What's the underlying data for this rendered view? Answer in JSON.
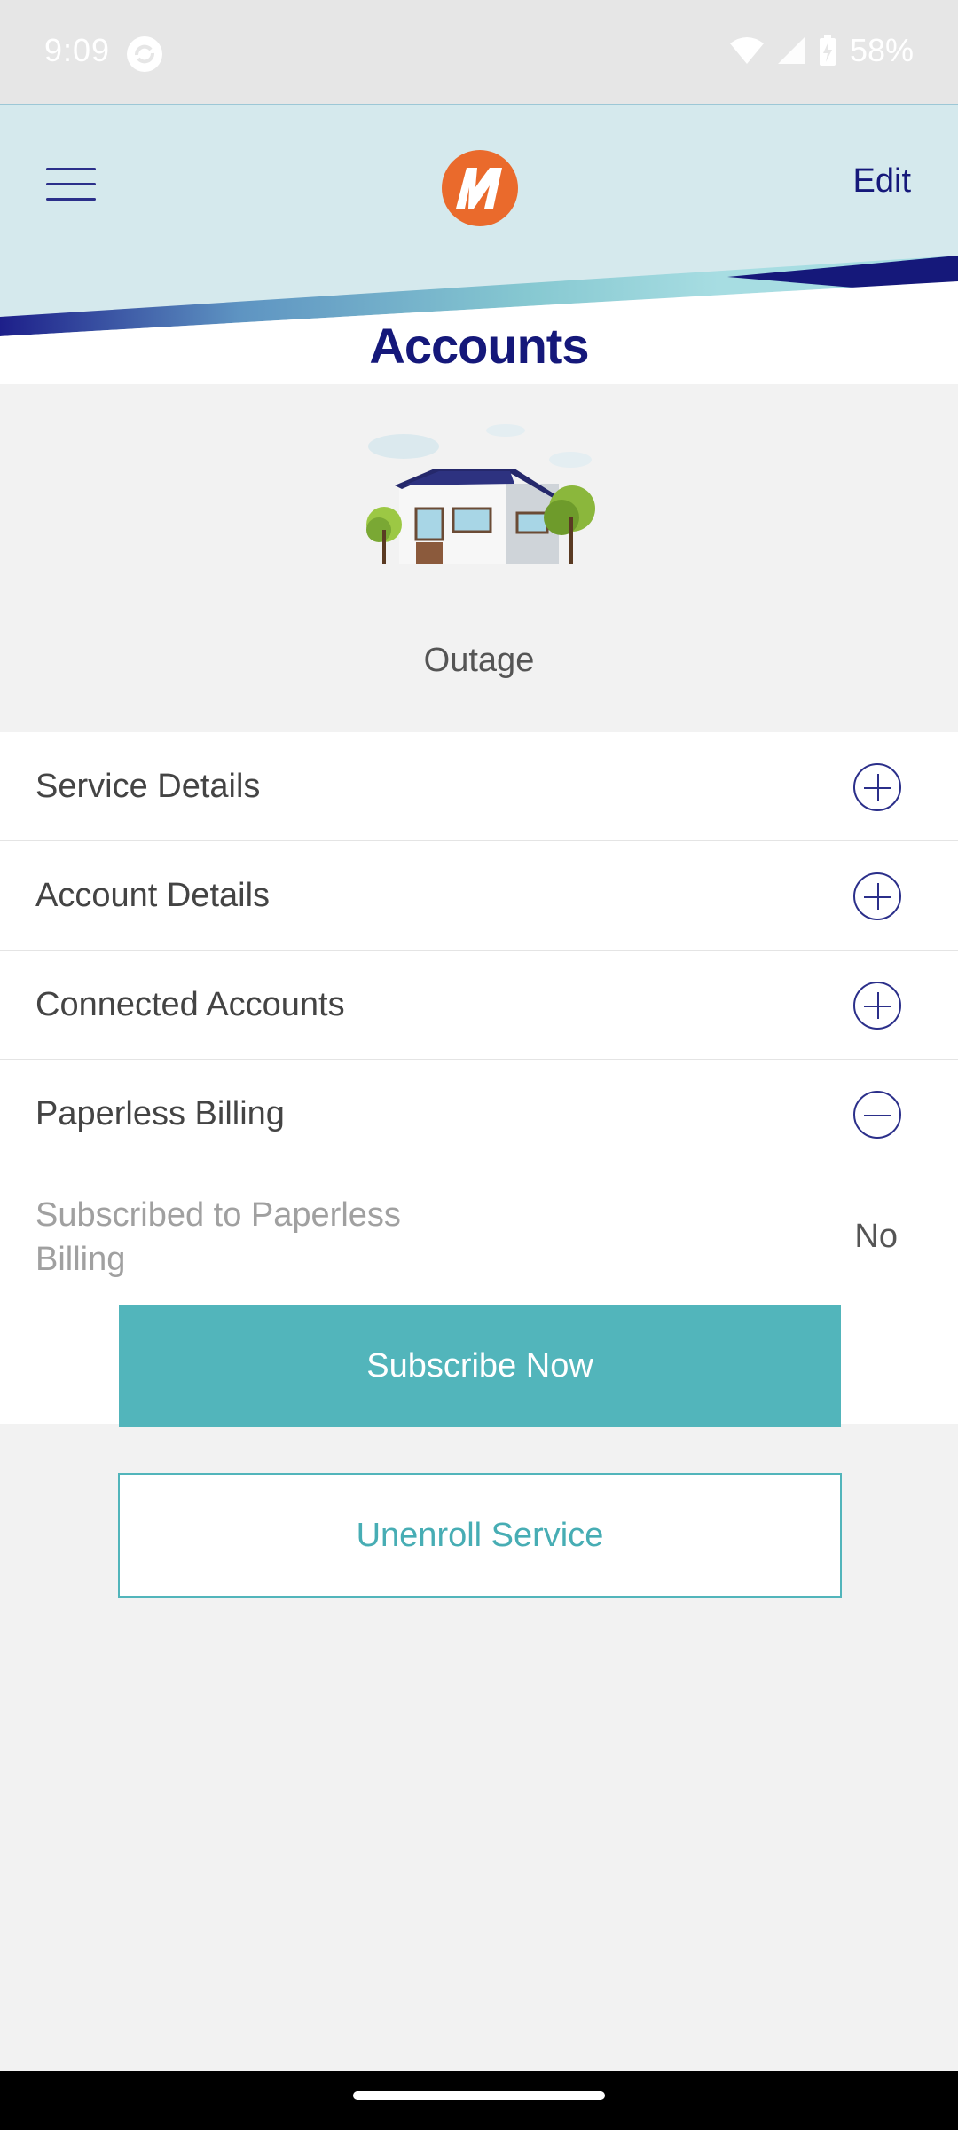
{
  "status_bar": {
    "time": "9:09",
    "battery": "58%",
    "icons": [
      "sync-icon",
      "wifi-icon",
      "signal-icon",
      "battery-charging-icon"
    ]
  },
  "header": {
    "menu_icon": "hamburger-menu-icon",
    "logo_icon": "lightning-m-logo-icon",
    "edit_label": "Edit",
    "title": "Accounts"
  },
  "outage": {
    "image": "house-illustration",
    "label": "Outage"
  },
  "sections": [
    {
      "label": "Service Details",
      "state": "collapsed"
    },
    {
      "label": "Account Details",
      "state": "collapsed"
    },
    {
      "label": "Connected Accounts",
      "state": "collapsed"
    },
    {
      "label": "Paperless Billing",
      "state": "expanded"
    }
  ],
  "paperless": {
    "field_label": "Subscribed to Paperless Billing",
    "field_value": "No",
    "subscribe_label": "Subscribe Now"
  },
  "unenroll_label": "Unenroll Service",
  "colors": {
    "brand_navy": "#15187a",
    "accent_teal": "#52b5bb",
    "logo_orange": "#ea6a2c",
    "header_bg": "#d5e9ed"
  }
}
